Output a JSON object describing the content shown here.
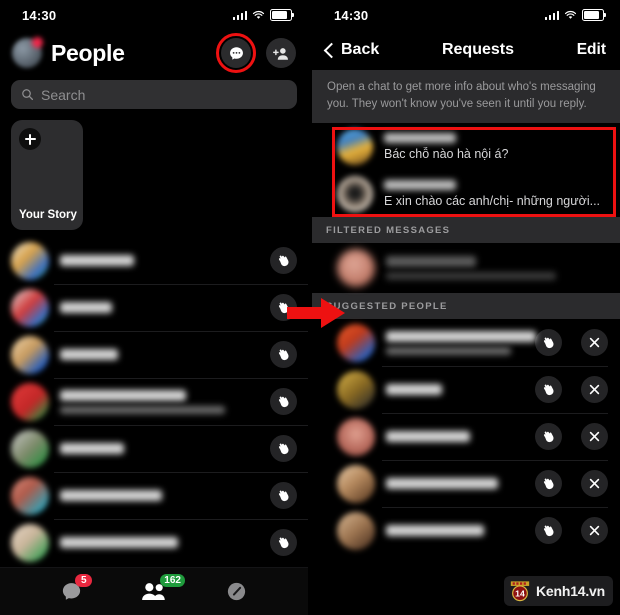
{
  "meta": {
    "accent_red": "#ee1111",
    "badge_red": "#e8283f",
    "badge_green": "#1f9b3c",
    "bg": "#000000",
    "panel_surface": "#2b2b2d"
  },
  "left": {
    "status": {
      "time": "14:30",
      "signal_icon": "signal-bars-icon",
      "wifi_icon": "wifi-icon",
      "battery_icon": "battery-icon"
    },
    "header": {
      "avatar": "profile-avatar",
      "title": "People",
      "chat_button_icon": "chat-bubble-icon",
      "add_person_button_icon": "add-person-icon",
      "highlighted_button": "chat-bubble-icon"
    },
    "search": {
      "placeholder": "Search",
      "icon": "search-icon"
    },
    "story": {
      "label": "Your Story",
      "add_icon": "plus-icon"
    },
    "contacts": [
      {
        "name": "",
        "sub": "",
        "action_icon": "wave-hand-icon",
        "avatar_color": "linear-gradient(135deg,#e8e3d8 0%,#d8a24a 40%,#3a6fc4 75%,#2aa84a 100%)",
        "name_w": 74,
        "has_sub": false
      },
      {
        "name": "",
        "sub": "",
        "action_icon": "wave-hand-icon",
        "avatar_color": "linear-gradient(135deg,#e0e0e0 0%,#d03b3b 45%,#3a6fc4 78%,#2aa84a 100%)",
        "name_w": 52,
        "has_sub": false
      },
      {
        "name": "",
        "sub": "",
        "action_icon": "wave-hand-icon",
        "avatar_color": "linear-gradient(135deg,#f0d7b0 0%,#c79a5e 45%,#2b5fb8 80%,#1d4f9c 100%)",
        "name_w": 58,
        "has_sub": false
      },
      {
        "name": "",
        "sub": "",
        "action_icon": "wave-hand-icon",
        "avatar_color": "linear-gradient(135deg,#e33b3b 0%,#c22727 55%,#2f8f43 90%)",
        "name_w": 126,
        "has_sub": true
      },
      {
        "name": "",
        "sub": "",
        "action_icon": "wave-hand-icon",
        "avatar_color": "linear-gradient(135deg,#c9c9c9 0%,#7d8a6a 50%,#2f8f43 88%)",
        "name_w": 64,
        "has_sub": false
      },
      {
        "name": "",
        "sub": "",
        "action_icon": "wave-hand-icon",
        "avatar_color": "linear-gradient(135deg,#d98d7e 0%,#b05a4a 40%,#2fa3b8 85%)",
        "name_w": 102,
        "has_sub": false
      },
      {
        "name": "",
        "sub": "",
        "action_icon": "wave-hand-icon",
        "avatar_color": "linear-gradient(135deg,#e8d9c8 0%,#c9b49a 45%,#3aa055 88%)",
        "name_w": 118,
        "has_sub": false
      }
    ],
    "tabs": [
      {
        "name": "chats-tab",
        "icon": "chat-bubble-icon",
        "badge": "5",
        "badge_color": "red"
      },
      {
        "name": "people-tab",
        "icon": "people-icon",
        "badge": "162",
        "badge_color": "green"
      },
      {
        "name": "discover-tab",
        "icon": "compass-icon",
        "badge": "",
        "badge_color": ""
      }
    ]
  },
  "right": {
    "status": {
      "time": "14:30",
      "signal_icon": "signal-bars-icon",
      "wifi_icon": "wifi-icon",
      "battery_icon": "battery-icon"
    },
    "header": {
      "back_label": "Back",
      "back_icon": "chevron-left-icon",
      "title": "Requests",
      "edit_label": "Edit"
    },
    "notice": "Open a chat to get more info about who's messaging you. They won't know you've seen it until you reply.",
    "requests": [
      {
        "name": "",
        "message": "Bác chỗ nào hà nội á?",
        "avatar_color": "linear-gradient(160deg,#5fb4e8 0%,#3f7fbf 32%,#e8b23a 58%,#6b4a1f 100%)"
      },
      {
        "name": "",
        "message": "E xin chào các anh/chị-  những người...",
        "avatar_color": "radial-gradient(circle at 50% 48%,#1a1a1a 18%,#8a7c6e 46%,#d8cfc4 72%,#6b6257 100%)"
      }
    ],
    "sections": {
      "filtered_messages": "FILTERED MESSAGES",
      "suggested_people": "SUGGESTED PEOPLE"
    },
    "filtered": [
      {
        "name": "",
        "sub": "",
        "avatar_color": "radial-gradient(circle at 45% 40%,#e0a898,#c07a68 60%,#8d4f41)"
      }
    ],
    "suggested": [
      {
        "name": "",
        "sub": "",
        "wave_icon": "wave-hand-icon",
        "close_icon": "close-icon",
        "avatar_color": "linear-gradient(140deg,#e85a2a 0%,#c03b1c 42%,#2f5fb8 80%,#1d4f9c 100%)",
        "name_w": 150,
        "has_sub": true
      },
      {
        "name": "",
        "sub": "",
        "wave_icon": "wave-hand-icon",
        "close_icon": "close-icon",
        "avatar_color": "linear-gradient(140deg,#d8b44a 0%,#8a6a22 50%,#2a2a2a 95%)",
        "name_w": 56,
        "has_sub": false
      },
      {
        "name": "",
        "sub": "",
        "wave_icon": "wave-hand-icon",
        "close_icon": "close-icon",
        "avatar_color": "radial-gradient(circle at 50% 42%,#e0a090,#b5675a 58%,#7a3d33)",
        "name_w": 84,
        "has_sub": false
      },
      {
        "name": "",
        "sub": "",
        "wave_icon": "wave-hand-icon",
        "close_icon": "close-icon",
        "avatar_color": "linear-gradient(140deg,#e8cba8 0%,#b5895e 45%,#5a3a22 95%)",
        "name_w": 112,
        "has_sub": false
      },
      {
        "name": "",
        "sub": "",
        "wave_icon": "wave-hand-icon",
        "close_icon": "close-icon",
        "avatar_color": "linear-gradient(140deg,#d8b894 0%,#9c7450 50%,#4a3020 95%)",
        "name_w": 98,
        "has_sub": false
      }
    ]
  },
  "annotations": {
    "arrow": "red-right-arrow",
    "highlight_box": "red-highlight-box",
    "highlight_circle": "red-highlight-circle"
  },
  "watermark": {
    "logo_number": "14",
    "text": "Kenh14.vn"
  }
}
